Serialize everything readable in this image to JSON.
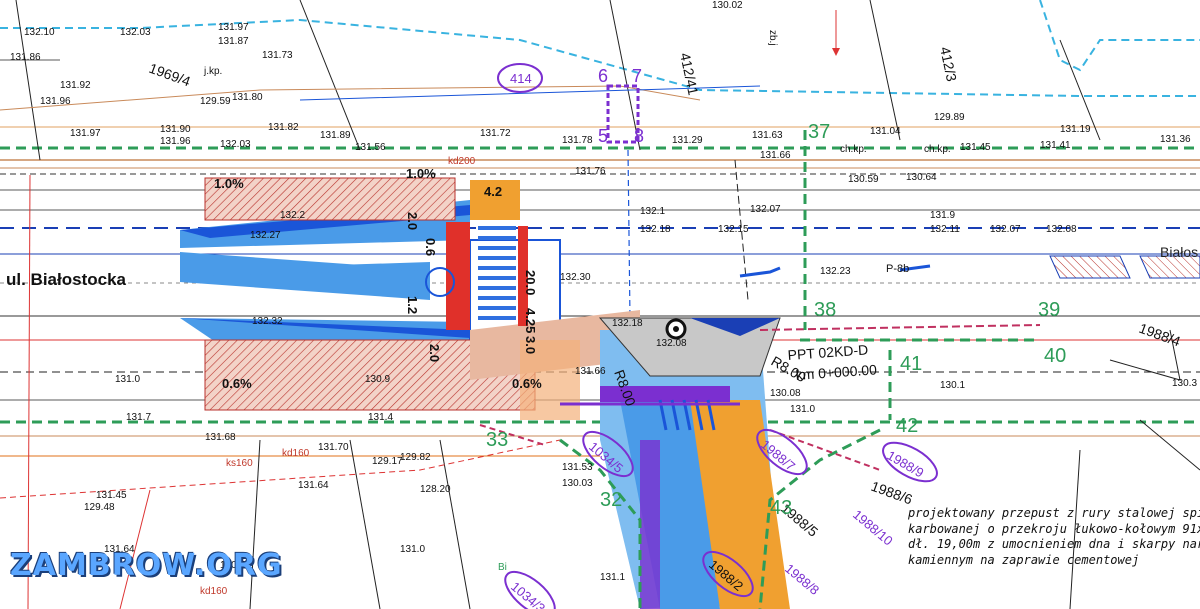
{
  "street_label": "ul. Białostocka",
  "street_label_right": "Białos",
  "project_note": "projektowany przepust z rury stalowej spiralni\nkarbowanej o przekroju łukowo-kołowym 91x66\ndł. 19,00m z umocnieniem dna i skarpy narzute\nkamiennym na zaprawie cementowej",
  "watermark": "ZAMBROW.ORG",
  "culvert_label": "PPT 02KD-D",
  "chainage_label": "km 0+000.00",
  "radius_label_1": "R8.00",
  "radius_label_2": "R8.00",
  "marking_label": "P-8b",
  "parcels": {
    "p412_41": "412/41",
    "p412_3": "412/3",
    "p1969_4": "1969/4",
    "p414": "414",
    "p1988_4": "1988/4",
    "p1988_7": "1988/7",
    "p1988_9": "1988/9",
    "p1988_6": "1988/6",
    "p1988_10": "1988/10",
    "p1988_5": "1988/5",
    "p1988_8": "1988/8",
    "p1988_2": "1988/2",
    "p1034_5": "1034/5",
    "p1034_3": "1034/3"
  },
  "points": [
    "6",
    "7",
    "5",
    "8",
    "37",
    "38",
    "39",
    "40",
    "41",
    "42",
    "32",
    "33",
    "43"
  ],
  "elevations": {
    "e1": "132.10",
    "e2": "132.03",
    "e3": "131.97",
    "e4": "131.87",
    "e5": "131.92",
    "e6": "131.96",
    "e7": "131.97",
    "e8": "131.96",
    "e9": "131.90",
    "e10": "131.82",
    "e11": "131.89",
    "e12": "132.03",
    "e13": "131.56",
    "e14": "131.72",
    "e15": "131.78",
    "e16": "131.29",
    "e17": "131.63",
    "e18": "131.66",
    "e19": "131.04",
    "e20": "131.45",
    "e21": "131.41",
    "e22": "131.19",
    "e23": "131.36",
    "e24": "131.76",
    "e25": "132.1",
    "e26": "132.18",
    "e27": "132.15",
    "e28": "132.07",
    "e29": "131.9",
    "e30": "132.11",
    "e31": "132.07",
    "e32": "132.08",
    "e33": "132.2",
    "e34": "132.27",
    "e35": "132.30",
    "e36": "132.23",
    "e37": "132.32",
    "e38": "131.0",
    "e39": "130.9",
    "e40": "131.66",
    "e41": "132.18",
    "e42": "132.08",
    "e43": "130.08",
    "e44": "130.1",
    "e45": "131.0",
    "e46": "131.68",
    "e47": "131.70",
    "e48": "129.17",
    "e49": "129.82",
    "e50": "128.20",
    "e51": "131.45",
    "e52": "129.48",
    "e53": "131.64",
    "e54": "131.64",
    "e55": "131.0",
    "e56": "130.7",
    "e57": "131.53",
    "e58": "130.03",
    "e59": "131.1",
    "e60": "131.7",
    "e61": "131.4",
    "e62": "130.59",
    "e63": "130.64",
    "e64": "130.3",
    "e65": "131.80",
    "e66": "131.73",
    "e67": "129.59",
    "e68": "129.89",
    "e69": "130.02",
    "e70": "131.86"
  },
  "dimensions": {
    "d1": "1.0%",
    "d2": "1.0%",
    "d3": "4.2",
    "d4": "2.0",
    "d5": "0.6",
    "d6": "1.2",
    "d7": "2.0",
    "d8": "0.6%",
    "d9": "0.6%",
    "d10": "20.0",
    "d11": "4.25",
    "d12": "3.0"
  },
  "utility_labels": {
    "u1": "kd200",
    "u2": "ks160",
    "u3": "kd160",
    "u4": "kd160",
    "u5": "ch.kp.",
    "u6": "ch.kp.",
    "u7": "j.kp.",
    "u8": "zb.j",
    "u9": "Bi"
  },
  "colors": {
    "road_blue": "#4a9be8",
    "kerb_blue": "#1a55d8",
    "hatch_red": "#b8322c",
    "parcel_green": "#2e9c58",
    "purple": "#7b2fd0",
    "orange": "#f0a030",
    "crosswalk": "#2f6fe0",
    "red_strip": "#e0302a"
  }
}
